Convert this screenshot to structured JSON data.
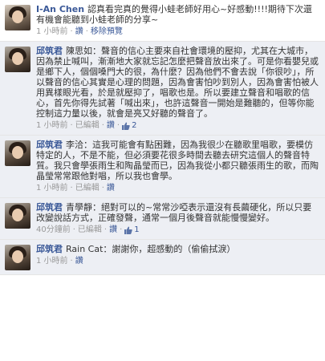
{
  "comments": [
    {
      "author": "I-An Chen",
      "text": "認真看完真的覺得小蛙老師好用心~好感動!!!!期待下次還有機會能聽到小蛙老師的分享~",
      "time": "1 小時前",
      "like_label": "讚",
      "remove_label": "移除預覽",
      "like_count": "",
      "edited": ""
    },
    {
      "author": "邱筑君",
      "text": "陳思如：聲音的信心主要來自社會環境的壓抑，尤其在大城市，因為禁止喊叫，漸漸地大家就忘記怎麼把聲音放出來了。可是你看嬰兒或是鄉下人，個個嗓門大的很，為什麼？因為他們不會去說「你很吵」，所以聲音的信心其實是心理的問題，因為會害怕吵到別人，因為會害怕被人用異樣眼光看，於是就壓抑了，唱歌也是。所以要建立聲音和唱歌的信心，首先你得先試著「喊出來」，也許這聲音一開始是難聽的，但等你能控制這力量以後，就會是亮又好聽的聲音了。",
      "time": "1 小時前",
      "like_label": "讚",
      "edited": "已編輯",
      "like_count": "2"
    },
    {
      "author": "邱筑君",
      "text": "李洽：這我可能會有點困難，因為我很少在聽歌里唱歌，要模仿特定的人，不是不能，但必須要花很多時間去聽去研究這個人的聲音特質。我只會學張雨生和陶晶瑩而已，因為我從小都只聽張雨生的歌，而陶晶瑩常常跟他對唱，所以我也會學。",
      "time": "1 小時前",
      "like_label": "讚",
      "edited": "已編輯",
      "like_count": ""
    },
    {
      "author": "邱筑君",
      "text": "青學靜：絕對可以的~常常沙啞表示還沒有長繭硬化，所以只要改變說話方式，正確發聲，通常一個月後聲音就能慢慢變好。",
      "time": "40分鐘前",
      "like_label": "讚",
      "edited": "已編輯",
      "like_count": "1"
    },
    {
      "author": "邱筑君",
      "text": "Rain Cat：謝謝你，超感動的（偷偷拭淚）",
      "time": "1 小時前",
      "like_label": "讚",
      "edited": "",
      "like_count": ""
    }
  ]
}
